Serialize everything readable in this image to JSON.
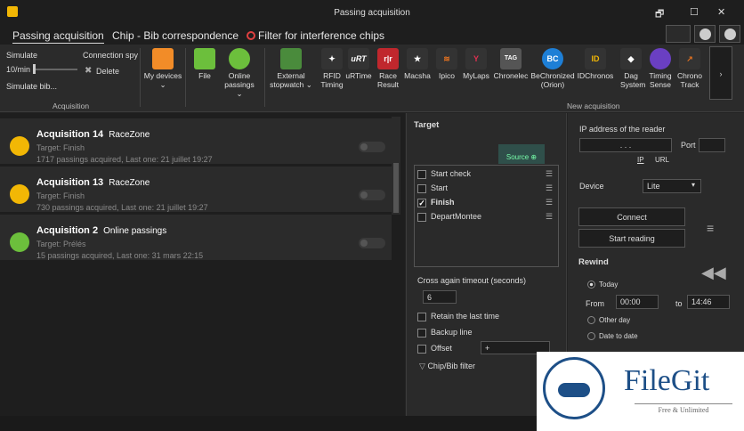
{
  "window": {
    "title": "Passing acquisition",
    "min": "🗗",
    "max": "☐",
    "close": "✕"
  },
  "tabs": [
    {
      "label": "Passing acquisition"
    },
    {
      "label": "Chip - Bib correspondence"
    },
    {
      "label": "Filter for interference chips"
    }
  ],
  "ribbon": {
    "simulate": "Simulate",
    "speed": "10/min",
    "simulate_bib": "Simulate bib...",
    "connection_spy": "Connection spy",
    "delete": "Delete",
    "group_acq": "Acquisition",
    "group_new": "New acquisition",
    "buttons": [
      {
        "label": "My devices",
        "icon": "folder-icon",
        "color": "#f28c28"
      },
      {
        "label": "File",
        "icon": "file-icon",
        "color": "#6cbf3c"
      },
      {
        "label": "Online passings",
        "icon": "cloud-icon",
        "color": "#6cbf3c"
      },
      {
        "label": "External stopwatch",
        "icon": "stopwatch-icon",
        "color": "#4a8b3c"
      },
      {
        "label": "RFID Timing",
        "icon": "rfid-icon",
        "color": "#333"
      },
      {
        "label": "uRTime",
        "icon": "urt-icon",
        "color": "#333",
        "glyph": "uRT"
      },
      {
        "label": "Race Result",
        "icon": "race-result-icon",
        "color": "#c0272d",
        "glyph": "r|r"
      },
      {
        "label": "Macsha",
        "icon": "macsha-icon",
        "color": "#333"
      },
      {
        "label": "Ipico",
        "icon": "ipico-icon",
        "color": "#333"
      },
      {
        "label": "MyLaps",
        "icon": "mylaps-icon",
        "color": "#333"
      },
      {
        "label": "Chronelec",
        "icon": "chronelec-icon",
        "color": "#555",
        "glyph": "TAG"
      },
      {
        "label": "BeChronized (Orion)",
        "icon": "bechronized-icon",
        "color": "#1e7fd6",
        "glyph": "BC"
      },
      {
        "label": "IDChronos",
        "icon": "idchronos-icon",
        "color": "#333",
        "glyph": "ID"
      },
      {
        "label": "Dag System",
        "icon": "dag-icon",
        "color": "#333"
      },
      {
        "label": "Timing Sense",
        "icon": "timing-sense-icon",
        "color": "#6a3fc2"
      },
      {
        "label": "Chrono Track",
        "icon": "chronotrack-icon",
        "color": "#333"
      }
    ]
  },
  "acquisitions": [
    {
      "title": "Acquisition 14",
      "kind": "RaceZone",
      "target": "Target: Finish",
      "info": "1717 passings acquired, Last one: 21 juillet 19:27"
    },
    {
      "title": "Acquisition 13",
      "kind": "RaceZone",
      "target": "Target: Finish",
      "info": "730 passings acquired, Last one: 21 juillet 19:27"
    },
    {
      "title": "Acquisition 2",
      "kind": "Online passings",
      "target": "Target: Prélés",
      "info": "15 passings acquired, Last one: 31 mars 22:15"
    }
  ],
  "target": {
    "heading": "Target",
    "source": "Source ⊕",
    "items": [
      {
        "label": "Start check",
        "checked": false
      },
      {
        "label": "Start",
        "checked": false
      },
      {
        "label": "Finish",
        "checked": true
      },
      {
        "label": "DepartMontee",
        "checked": false
      }
    ],
    "timeout_label": "Cross again timeout (seconds)",
    "timeout_value": "6",
    "retain": "Retain the last time",
    "backup": "Backup line",
    "offset": "Offset",
    "offset_prefix": "+",
    "filter": "Chip/Bib filter"
  },
  "reader": {
    "ip_label": "IP address of the reader",
    "ip_value": ".     .     .",
    "port_label": "Port",
    "ip_link": "IP",
    "url_link": "URL",
    "device_label": "Device",
    "device_value": "Lite",
    "connect": "Connect",
    "start_reading": "Start reading",
    "rewind": "Rewind",
    "today": "Today",
    "from_label": "From",
    "from_value": "00:00",
    "to_label": "to",
    "to_value": "14:46",
    "other_day": "Other day",
    "date_to_date": "Date to date"
  },
  "logo": {
    "name": "FileGit",
    "tagline": "Free & Unlimited"
  }
}
